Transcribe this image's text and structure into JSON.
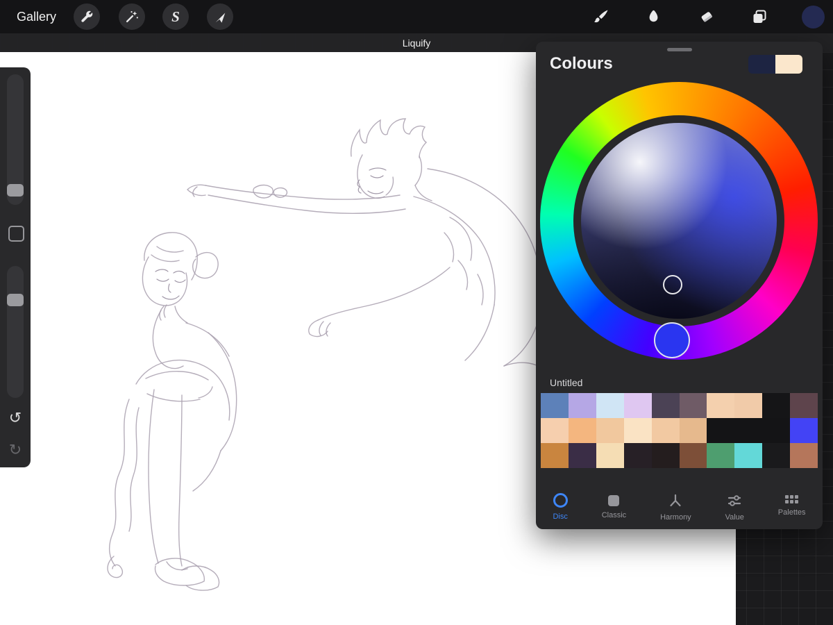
{
  "toolbar": {
    "gallery_label": "Gallery",
    "selection_glyph": "S",
    "current_color": "#242a52",
    "left_icons": [
      "wrench-icon",
      "adjustments-icon",
      "selection-icon",
      "transform-icon"
    ],
    "right_icons": [
      "brush-icon",
      "smudge-icon",
      "eraser-icon",
      "layers-icon",
      "color-swatch"
    ]
  },
  "modebar": {
    "title": "Liquify"
  },
  "icons": {
    "undo_glyph": "↺",
    "redo_glyph": "↻"
  },
  "colours_panel": {
    "title": "Colours",
    "accent_color": "#3e86f7",
    "recent_swatches": [
      "#1d2442",
      "#fbe7cc"
    ],
    "wheel": {
      "selected_color": "#2a35f0",
      "mode": "disc"
    },
    "palette": {
      "name": "Untitled",
      "rows": [
        [
          "#5d81b9",
          "#b5a7e5",
          "#d0e5f5",
          "#dfc7f1",
          "#4b4255",
          "#6f5b66",
          "#f4d0ae",
          "#f1cba9",
          "#151517",
          "#5e444c"
        ],
        [
          "#f6cfae",
          "#f4b67f",
          "#f1c89e",
          "#fae3c4",
          "#f2c9a2",
          "#e6b98d",
          "#141416",
          "#141416",
          "#141416",
          "#4343f5"
        ],
        [
          "#c9853f",
          "#3a2d46",
          "#f5ddb4",
          "#272026",
          "#241d1e",
          "#7d4f38",
          "#4e9e6f",
          "#63d8d8",
          "#1a1a1c",
          "#b5765b"
        ]
      ]
    },
    "tabs": [
      {
        "label": "Disc",
        "active": true
      },
      {
        "label": "Classic",
        "active": false
      },
      {
        "label": "Harmony",
        "active": false
      },
      {
        "label": "Value",
        "active": false
      },
      {
        "label": "Palettes",
        "active": false
      }
    ]
  }
}
